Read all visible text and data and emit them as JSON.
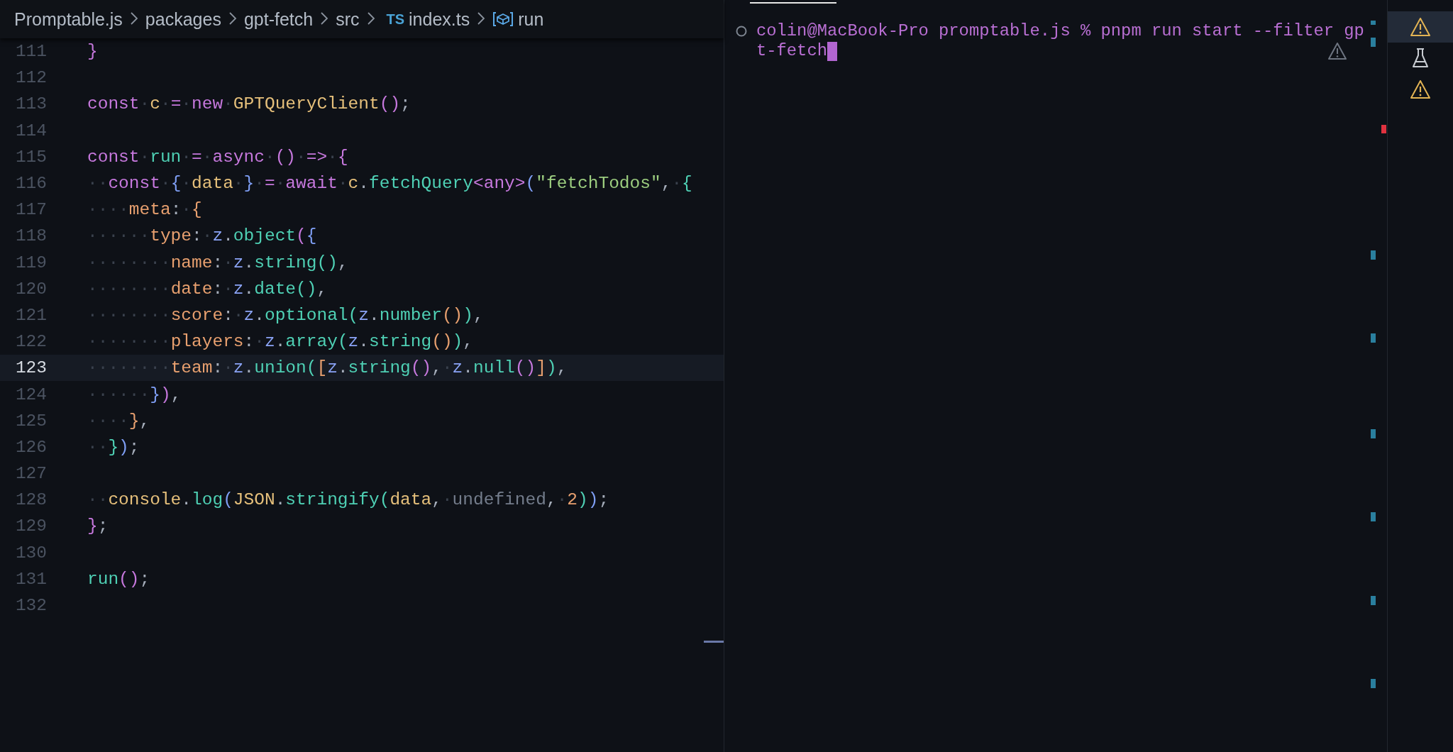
{
  "breadcrumb": [
    {
      "kind": "folder",
      "label": "Promptable.js"
    },
    {
      "kind": "folder",
      "label": "packages"
    },
    {
      "kind": "folder",
      "label": "gpt-fetch"
    },
    {
      "kind": "folder",
      "label": "src"
    },
    {
      "kind": "ts-file",
      "badge": "TS",
      "label": "index.ts"
    },
    {
      "kind": "symbol",
      "label": "run"
    }
  ],
  "editor": {
    "lines": [
      {
        "number": "111",
        "current": false,
        "tokens": [
          {
            "kind": "bp",
            "text": "}"
          }
        ]
      },
      {
        "number": "112",
        "current": false
      },
      {
        "number": "113",
        "current": false,
        "tokens": [
          {
            "kind": "kw",
            "text": "const"
          },
          {
            "kind": "ws",
            "text": "·"
          },
          {
            "kind": "var",
            "text": "c"
          },
          {
            "kind": "ws",
            "text": "·"
          },
          {
            "kind": "kw",
            "text": "="
          },
          {
            "kind": "ws",
            "text": "·"
          },
          {
            "kind": "kw",
            "text": "new"
          },
          {
            "kind": "ws",
            "text": "·"
          },
          {
            "kind": "var",
            "text": "GPTQueryClient"
          },
          {
            "kind": "bp",
            "text": "()"
          },
          {
            "kind": "p",
            "text": ";"
          }
        ]
      },
      {
        "number": "114",
        "current": false
      },
      {
        "number": "115",
        "current": false,
        "tokens": [
          {
            "kind": "kw",
            "text": "const"
          },
          {
            "kind": "ws",
            "text": "·"
          },
          {
            "kind": "fn",
            "text": "run"
          },
          {
            "kind": "ws",
            "text": "·"
          },
          {
            "kind": "kw",
            "text": "="
          },
          {
            "kind": "ws",
            "text": "·"
          },
          {
            "kind": "kw",
            "text": "async"
          },
          {
            "kind": "ws",
            "text": "·"
          },
          {
            "kind": "bp",
            "text": "()"
          },
          {
            "kind": "ws",
            "text": "·"
          },
          {
            "kind": "kw",
            "text": "=>"
          },
          {
            "kind": "ws",
            "text": "·"
          },
          {
            "kind": "bp",
            "text": "{"
          }
        ]
      },
      {
        "number": "116",
        "current": false,
        "tokens": [
          {
            "kind": "ws",
            "text": "··"
          },
          {
            "kind": "kw",
            "text": "const"
          },
          {
            "kind": "ws",
            "text": "·"
          },
          {
            "kind": "bb",
            "text": "{"
          },
          {
            "kind": "ws",
            "text": "·"
          },
          {
            "kind": "var",
            "text": "data"
          },
          {
            "kind": "ws",
            "text": "·"
          },
          {
            "kind": "bb",
            "text": "}"
          },
          {
            "kind": "ws",
            "text": "·"
          },
          {
            "kind": "kw",
            "text": "="
          },
          {
            "kind": "ws",
            "text": "·"
          },
          {
            "kind": "kw",
            "text": "await"
          },
          {
            "kind": "ws",
            "text": "·"
          },
          {
            "kind": "var",
            "text": "c"
          },
          {
            "kind": "p",
            "text": "."
          },
          {
            "kind": "fn",
            "text": "fetchQuery"
          },
          {
            "kind": "kw",
            "text": "<any>"
          },
          {
            "kind": "bb",
            "text": "("
          },
          {
            "kind": "str",
            "text": "\"fetchTodos\""
          },
          {
            "kind": "p",
            "text": ","
          },
          {
            "kind": "ws",
            "text": "·"
          },
          {
            "kind": "bt",
            "text": "{"
          }
        ]
      },
      {
        "number": "117",
        "current": false,
        "tokens": [
          {
            "kind": "ws",
            "text": "····"
          },
          {
            "kind": "prop",
            "text": "meta"
          },
          {
            "kind": "p",
            "text": ":"
          },
          {
            "kind": "ws",
            "text": "·"
          },
          {
            "kind": "bo",
            "text": "{"
          }
        ]
      },
      {
        "number": "118",
        "current": false,
        "tokens": [
          {
            "kind": "ws",
            "text": "······"
          },
          {
            "kind": "prop",
            "text": "type"
          },
          {
            "kind": "p",
            "text": ":"
          },
          {
            "kind": "ws",
            "text": "·"
          },
          {
            "kind": "ns",
            "text": "z"
          },
          {
            "kind": "p",
            "text": "."
          },
          {
            "kind": "fn",
            "text": "object"
          },
          {
            "kind": "bp",
            "text": "("
          },
          {
            "kind": "bb",
            "text": "{"
          }
        ]
      },
      {
        "number": "119",
        "current": false,
        "tokens": [
          {
            "kind": "ws",
            "text": "········"
          },
          {
            "kind": "prop",
            "text": "name"
          },
          {
            "kind": "p",
            "text": ":"
          },
          {
            "kind": "ws",
            "text": "·"
          },
          {
            "kind": "ns",
            "text": "z"
          },
          {
            "kind": "p",
            "text": "."
          },
          {
            "kind": "fn",
            "text": "string"
          },
          {
            "kind": "bt",
            "text": "()"
          },
          {
            "kind": "p",
            "text": ","
          }
        ]
      },
      {
        "number": "120",
        "current": false,
        "tokens": [
          {
            "kind": "ws",
            "text": "········"
          },
          {
            "kind": "prop",
            "text": "date"
          },
          {
            "kind": "p",
            "text": ":"
          },
          {
            "kind": "ws",
            "text": "·"
          },
          {
            "kind": "ns",
            "text": "z"
          },
          {
            "kind": "p",
            "text": "."
          },
          {
            "kind": "fn",
            "text": "date"
          },
          {
            "kind": "bt",
            "text": "()"
          },
          {
            "kind": "p",
            "text": ","
          }
        ]
      },
      {
        "number": "121",
        "current": false,
        "tokens": [
          {
            "kind": "ws",
            "text": "········"
          },
          {
            "kind": "prop",
            "text": "score"
          },
          {
            "kind": "p",
            "text": ":"
          },
          {
            "kind": "ws",
            "text": "·"
          },
          {
            "kind": "ns",
            "text": "z"
          },
          {
            "kind": "p",
            "text": "."
          },
          {
            "kind": "fn",
            "text": "optional"
          },
          {
            "kind": "bt",
            "text": "("
          },
          {
            "kind": "ns",
            "text": "z"
          },
          {
            "kind": "p",
            "text": "."
          },
          {
            "kind": "fn",
            "text": "number"
          },
          {
            "kind": "bo",
            "text": "()"
          },
          {
            "kind": "bt",
            "text": ")"
          },
          {
            "kind": "p",
            "text": ","
          }
        ]
      },
      {
        "number": "122",
        "current": false,
        "tokens": [
          {
            "kind": "ws",
            "text": "········"
          },
          {
            "kind": "prop",
            "text": "players"
          },
          {
            "kind": "p",
            "text": ":"
          },
          {
            "kind": "ws",
            "text": "·"
          },
          {
            "kind": "ns",
            "text": "z"
          },
          {
            "kind": "p",
            "text": "."
          },
          {
            "kind": "fn",
            "text": "array"
          },
          {
            "kind": "bt",
            "text": "("
          },
          {
            "kind": "ns",
            "text": "z"
          },
          {
            "kind": "p",
            "text": "."
          },
          {
            "kind": "fn",
            "text": "string"
          },
          {
            "kind": "bo",
            "text": "()"
          },
          {
            "kind": "bt",
            "text": ")"
          },
          {
            "kind": "p",
            "text": ","
          }
        ]
      },
      {
        "number": "123",
        "current": true,
        "tokens": [
          {
            "kind": "ws",
            "text": "········"
          },
          {
            "kind": "prop",
            "text": "team"
          },
          {
            "kind": "p",
            "text": ":"
          },
          {
            "kind": "ws",
            "text": "·"
          },
          {
            "kind": "ns",
            "text": "z"
          },
          {
            "kind": "p",
            "text": "."
          },
          {
            "kind": "fn",
            "text": "union"
          },
          {
            "kind": "bt",
            "text": "("
          },
          {
            "kind": "bo",
            "text": "["
          },
          {
            "kind": "ns",
            "text": "z"
          },
          {
            "kind": "p",
            "text": "."
          },
          {
            "kind": "fn",
            "text": "string"
          },
          {
            "kind": "bp",
            "text": "()"
          },
          {
            "kind": "p",
            "text": ","
          },
          {
            "kind": "ws",
            "text": "·"
          },
          {
            "kind": "ns",
            "text": "z"
          },
          {
            "kind": "p",
            "text": "."
          },
          {
            "kind": "fn",
            "text": "null"
          },
          {
            "kind": "bp",
            "text": "()"
          },
          {
            "kind": "bo",
            "text": "]"
          },
          {
            "kind": "bt",
            "text": ")"
          },
          {
            "kind": "p",
            "text": ","
          }
        ]
      },
      {
        "number": "124",
        "current": false,
        "tokens": [
          {
            "kind": "ws",
            "text": "······"
          },
          {
            "kind": "bb",
            "text": "}"
          },
          {
            "kind": "bp",
            "text": ")"
          },
          {
            "kind": "p",
            "text": ","
          }
        ]
      },
      {
        "number": "125",
        "current": false,
        "tokens": [
          {
            "kind": "ws",
            "text": "····"
          },
          {
            "kind": "bo",
            "text": "}"
          },
          {
            "kind": "p",
            "text": ","
          }
        ]
      },
      {
        "number": "126",
        "current": false,
        "tokens": [
          {
            "kind": "ws",
            "text": "··"
          },
          {
            "kind": "bt",
            "text": "}"
          },
          {
            "kind": "bb",
            "text": ")"
          },
          {
            "kind": "p",
            "text": ";"
          }
        ]
      },
      {
        "number": "127",
        "current": false
      },
      {
        "number": "128",
        "current": false,
        "tokens": [
          {
            "kind": "ws",
            "text": "··"
          },
          {
            "kind": "var",
            "text": "console"
          },
          {
            "kind": "p",
            "text": "."
          },
          {
            "kind": "fn",
            "text": "log"
          },
          {
            "kind": "bb",
            "text": "("
          },
          {
            "kind": "var",
            "text": "JSON"
          },
          {
            "kind": "p",
            "text": "."
          },
          {
            "kind": "fn",
            "text": "stringify"
          },
          {
            "kind": "bt",
            "text": "("
          },
          {
            "kind": "var",
            "text": "data"
          },
          {
            "kind": "p",
            "text": ","
          },
          {
            "kind": "ws",
            "text": "·"
          },
          {
            "kind": "dim",
            "text": "undefined"
          },
          {
            "kind": "p",
            "text": ","
          },
          {
            "kind": "ws",
            "text": "·"
          },
          {
            "kind": "num",
            "text": "2"
          },
          {
            "kind": "bt",
            "text": ")"
          },
          {
            "kind": "bb",
            "text": ")"
          },
          {
            "kind": "p",
            "text": ";"
          }
        ]
      },
      {
        "number": "129",
        "current": false,
        "tokens": [
          {
            "kind": "bp",
            "text": "}"
          },
          {
            "kind": "p",
            "text": ";"
          }
        ]
      },
      {
        "number": "130",
        "current": false
      },
      {
        "number": "131",
        "current": false,
        "tokens": [
          {
            "kind": "fn",
            "text": "run"
          },
          {
            "kind": "bp",
            "text": "()"
          },
          {
            "kind": "p",
            "text": ";"
          }
        ]
      },
      {
        "number": "132",
        "current": false
      }
    ]
  },
  "terminal": {
    "lines": [
      "colin@MacBook-Pro promptable.js % pnpm run start --filter gp",
      "t-fetch"
    ]
  },
  "terminal_list": [
    {
      "kind": "warning",
      "selected": true
    },
    {
      "kind": "flask",
      "selected": false
    },
    {
      "kind": "warning",
      "selected": false
    }
  ]
}
